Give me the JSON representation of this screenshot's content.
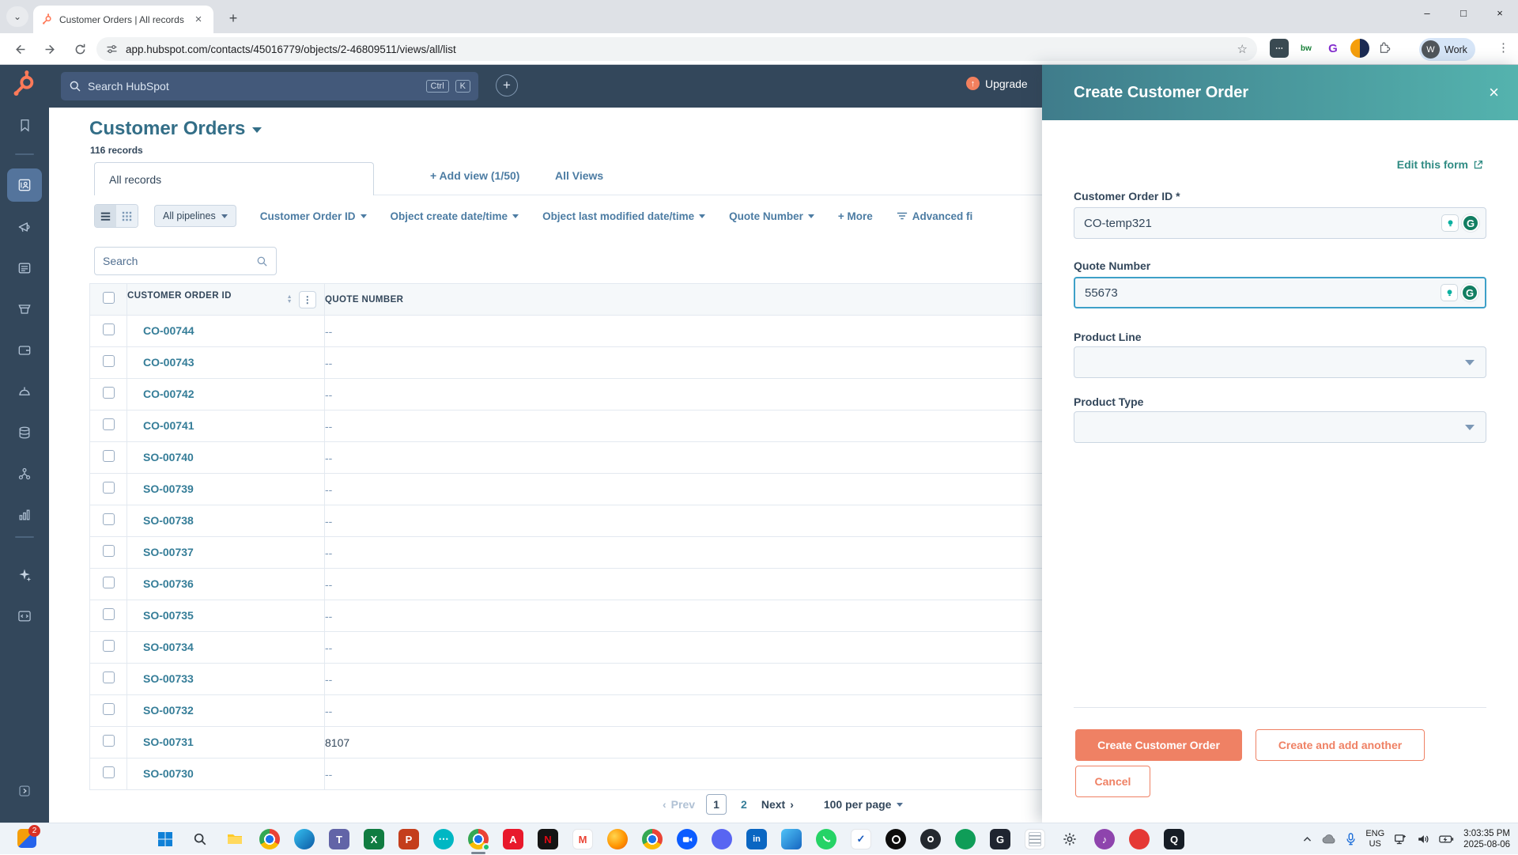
{
  "browser": {
    "tab_title": "Customer Orders | All records",
    "url": "app.hubspot.com/contacts/45016779/objects/2-46809511/views/all/list",
    "profile": {
      "initial": "W",
      "label": "Work"
    }
  },
  "hubspot_nav": {
    "search_placeholder": "Search HubSpot",
    "shortcut": {
      "ctrl": "Ctrl",
      "k": "K"
    },
    "upgrade_label": "Upgrade"
  },
  "page": {
    "title": "Customer Orders",
    "record_count": "116 records",
    "tabs": {
      "active": "All records",
      "add_view": "+ Add view (1/50)",
      "all_views": "All Views"
    },
    "filter_bar": {
      "pipelines": "All pipelines",
      "filters": [
        "Customer Order ID",
        "Object create date/time",
        "Object last modified date/time",
        "Quote Number"
      ],
      "more": "+ More",
      "advanced": "Advanced fi"
    },
    "search_placeholder": "Search",
    "table": {
      "columns": [
        "CUSTOMER ORDER ID",
        "QUOTE NUMBER"
      ],
      "rows": [
        {
          "id": "CO-00744",
          "quote": "--"
        },
        {
          "id": "CO-00743",
          "quote": "--"
        },
        {
          "id": "CO-00742",
          "quote": "--"
        },
        {
          "id": "CO-00741",
          "quote": "--"
        },
        {
          "id": "SO-00740",
          "quote": "--"
        },
        {
          "id": "SO-00739",
          "quote": "--"
        },
        {
          "id": "SO-00738",
          "quote": "--"
        },
        {
          "id": "SO-00737",
          "quote": "--"
        },
        {
          "id": "SO-00736",
          "quote": "--"
        },
        {
          "id": "SO-00735",
          "quote": "--"
        },
        {
          "id": "SO-00734",
          "quote": "--"
        },
        {
          "id": "SO-00733",
          "quote": "--"
        },
        {
          "id": "SO-00732",
          "quote": "--"
        },
        {
          "id": "SO-00731",
          "quote": "8107"
        },
        {
          "id": "SO-00730",
          "quote": "--"
        }
      ]
    },
    "pagination": {
      "prev": "Prev",
      "page1": "1",
      "page2": "2",
      "next": "Next",
      "per_page": "100 per page"
    }
  },
  "panel": {
    "title": "Create Customer Order",
    "edit_link": "Edit this form",
    "fields": {
      "customer_order_id": {
        "label": "Customer Order ID *",
        "value": "CO-temp321"
      },
      "quote_number": {
        "label": "Quote Number",
        "value": "55673"
      },
      "product_line": {
        "label": "Product Line",
        "value": ""
      },
      "product_type": {
        "label": "Product Type",
        "value": ""
      }
    },
    "buttons": {
      "create": "Create Customer Order",
      "create_add": "Create and add another",
      "cancel": "Cancel"
    }
  },
  "taskbar": {
    "overflow_badge": "2",
    "tray": {
      "language": "ENG",
      "region": "US",
      "time": "3:03:35 PM",
      "date": "2025-08-06"
    }
  },
  "colors": {
    "hubspot_orange": "#ff7a59",
    "nav_bg": "#33475b",
    "panel_header_start": "#3f7c8b",
    "panel_header_end": "#54b3ae",
    "primary_button": "#ef8164",
    "filter_link": "#4c7ca3",
    "record_link": "#357d98",
    "focus_border": "#3da0c8"
  }
}
